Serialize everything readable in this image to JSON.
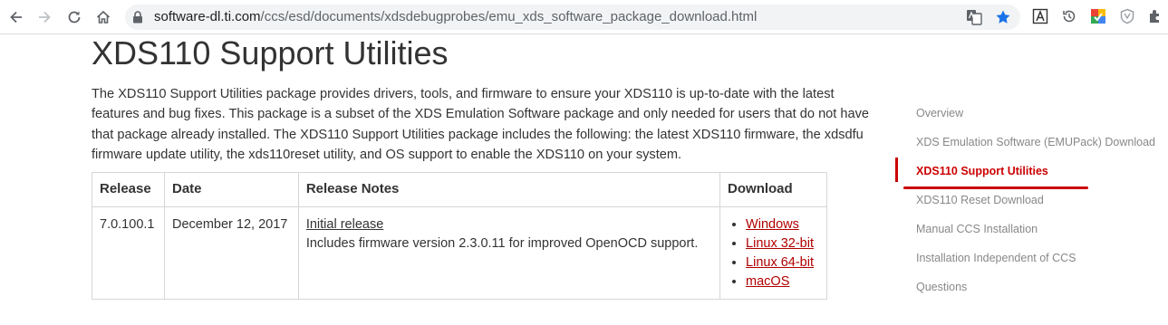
{
  "browser": {
    "url_host": "software-dl.ti.com",
    "url_path": "/ccs/esd/documents/xdsdebugprobes/emu_xds_software_package_download.html"
  },
  "page": {
    "title": "XDS110 Support Utilities",
    "intro": "The XDS110 Support Utilities package provides drivers, tools, and firmware to ensure your XDS110 is up-to-date with the latest features and bug fixes. This package is a subset of the XDS Emulation Software package and only needed for users that do not have that package already installed. The XDS110 Support Utilities package includes the following: the latest XDS110 firmware, the xdsdfu firmware update utility, the xds110reset utility, and OS support to enable the XDS110 on your system."
  },
  "table": {
    "headers": [
      "Release",
      "Date",
      "Release Notes",
      "Download"
    ],
    "rows": [
      {
        "release": "7.0.100.1",
        "date": "December 12, 2017",
        "notes_link": "Initial release",
        "notes_text": "Includes firmware version 2.3.0.11 for improved OpenOCD support.",
        "downloads": [
          "Windows",
          "Linux 32-bit",
          "Linux 64-bit",
          "macOS"
        ]
      }
    ]
  },
  "sidenav": {
    "items": [
      "Overview",
      "XDS Emulation Software (EMUPack) Download",
      "XDS110 Support Utilities",
      "XDS110 Reset Download",
      "Manual CCS Installation",
      "Installation Independent of CCS",
      "Questions"
    ],
    "active_index": 2,
    "active_color": "#cc0000"
  }
}
